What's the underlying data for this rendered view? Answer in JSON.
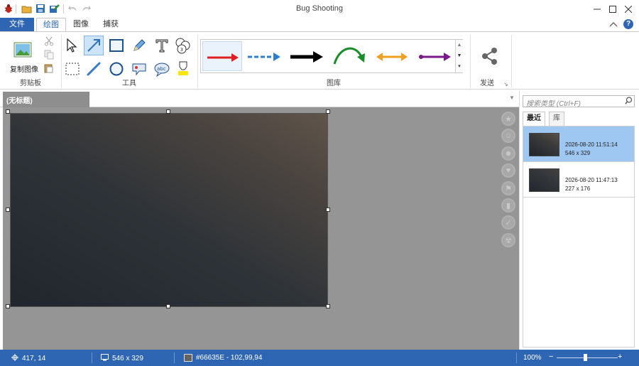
{
  "app": {
    "title": "Bug Shooting"
  },
  "tabs": [
    {
      "label": "文件"
    },
    {
      "label": "绘图"
    },
    {
      "label": "图像"
    },
    {
      "label": "捕获"
    }
  ],
  "ribbon": {
    "clipboard": {
      "copy_label": "复制图像",
      "group_label": "剪贴板"
    },
    "tools": {
      "group_label": "工具",
      "selected_tool": "arrow-tool"
    },
    "gallery": {
      "group_label": "图库",
      "arrows": [
        {
          "name": "red-arrow",
          "color": "#e02020"
        },
        {
          "name": "blue-dashed-arrow",
          "color": "#2a7fd4"
        },
        {
          "name": "black-arrow",
          "color": "#000000"
        },
        {
          "name": "green-curved-arrow",
          "color": "#1a8c2a"
        },
        {
          "name": "orange-double-arrow",
          "color": "#f0a020"
        },
        {
          "name": "purple-arrow",
          "color": "#7a1a8a"
        }
      ]
    },
    "send": {
      "group_label": "发送"
    }
  },
  "document": {
    "tab_label": "(无标题)"
  },
  "search": {
    "placeholder": "搜索类型 (Ctrl+F)"
  },
  "history_tabs": [
    {
      "label": "最近"
    },
    {
      "label": "库"
    }
  ],
  "history": [
    {
      "timestamp": "2026-08-20 11:51:14",
      "size": "546 x 329",
      "selected": true
    },
    {
      "timestamp": "2026-08-20 11:47:13",
      "size": "227 x 176",
      "selected": false
    }
  ],
  "status": {
    "cursor": "417, 14",
    "image_size": "546 x 329",
    "color": "#66635E - 102,99,94",
    "color_swatch": "#66635e",
    "zoom": "100%"
  }
}
